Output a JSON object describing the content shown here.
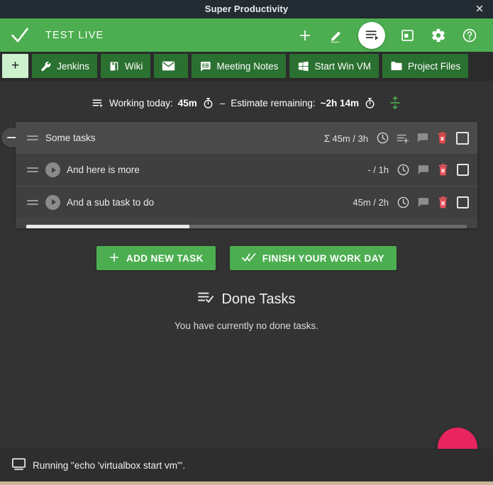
{
  "window": {
    "title": "Super Productivity",
    "close_label": "✕",
    "close_icon": "close-icon"
  },
  "header": {
    "check_icon": "check-icon",
    "project_title": "TEST LIVE",
    "accent_color": "#4cae50",
    "icons": [
      {
        "name": "add-task-icon",
        "label": "+"
      },
      {
        "name": "edit-pencil-icon",
        "label": ""
      },
      {
        "name": "task-list-icon",
        "label": "",
        "active": true
      },
      {
        "name": "calendar-icon",
        "label": ""
      },
      {
        "name": "settings-gear-icon",
        "label": ""
      },
      {
        "name": "help-circle-icon",
        "label": ""
      }
    ]
  },
  "bookmarks": {
    "add_label": "+",
    "items": [
      {
        "label": "Jenkins",
        "icon": "wrench-icon"
      },
      {
        "label": "Wiki",
        "icon": "book-icon"
      },
      {
        "label": "",
        "icon": "envelope-icon"
      },
      {
        "label": "Meeting Notes",
        "icon": "notes-bubble-icon"
      },
      {
        "label": "Start Win VM",
        "icon": "windows-logo-icon"
      },
      {
        "label": "Project Files",
        "icon": "folder-icon"
      }
    ]
  },
  "work_summary": {
    "list_icon": "task-list-play-icon",
    "working_label": "Working today:",
    "working_value": "45m",
    "timer_icon": "stopwatch-icon",
    "separator": "–",
    "estimate_label": "Estimate remaining:",
    "estimate_value": "~2h 14m",
    "split_icon": "split-time-icon"
  },
  "task_list": {
    "collapse_icon": "collapse-minus-icon",
    "parent": {
      "title": "Some tasks",
      "time_prefix": "Σ",
      "time_spent": "45m",
      "time_sep": "/",
      "time_estimate": "3h",
      "icons": [
        "clock-icon",
        "add-subtask-icon",
        "comment-icon",
        "delete-trash-icon"
      ],
      "checkbox": "task-checkbox"
    },
    "subtasks": [
      {
        "title": "And here is more",
        "time_spent": "-",
        "time_sep": "/",
        "time_estimate": "1h",
        "progress": 0,
        "play_icon": "play-icon",
        "icons": [
          "clock-icon",
          "comment-icon",
          "delete-trash-icon"
        ],
        "checkbox": "task-checkbox"
      },
      {
        "title": "And a sub task to do",
        "time_spent": "45m",
        "time_sep": "/",
        "time_estimate": "2h",
        "progress": 37,
        "play_icon": "play-icon",
        "icons": [
          "clock-icon",
          "comment-icon",
          "delete-trash-icon"
        ],
        "checkbox": "task-checkbox"
      }
    ]
  },
  "actions": {
    "add_task_label": "ADD NEW TASK",
    "add_task_icon": "plus-icon",
    "finish_day_label": "FINISH YOUR WORK DAY",
    "finish_day_icon": "double-check-icon"
  },
  "done_section": {
    "icon": "done-list-icon",
    "heading": "Done Tasks",
    "empty_text": "You have currently no done tasks."
  },
  "fab": {
    "name": "add-floating-button",
    "color": "#e8255f"
  },
  "status_bar": {
    "icon": "monitor-icon",
    "text": "Running \"echo 'virtualbox start vm'\"."
  }
}
